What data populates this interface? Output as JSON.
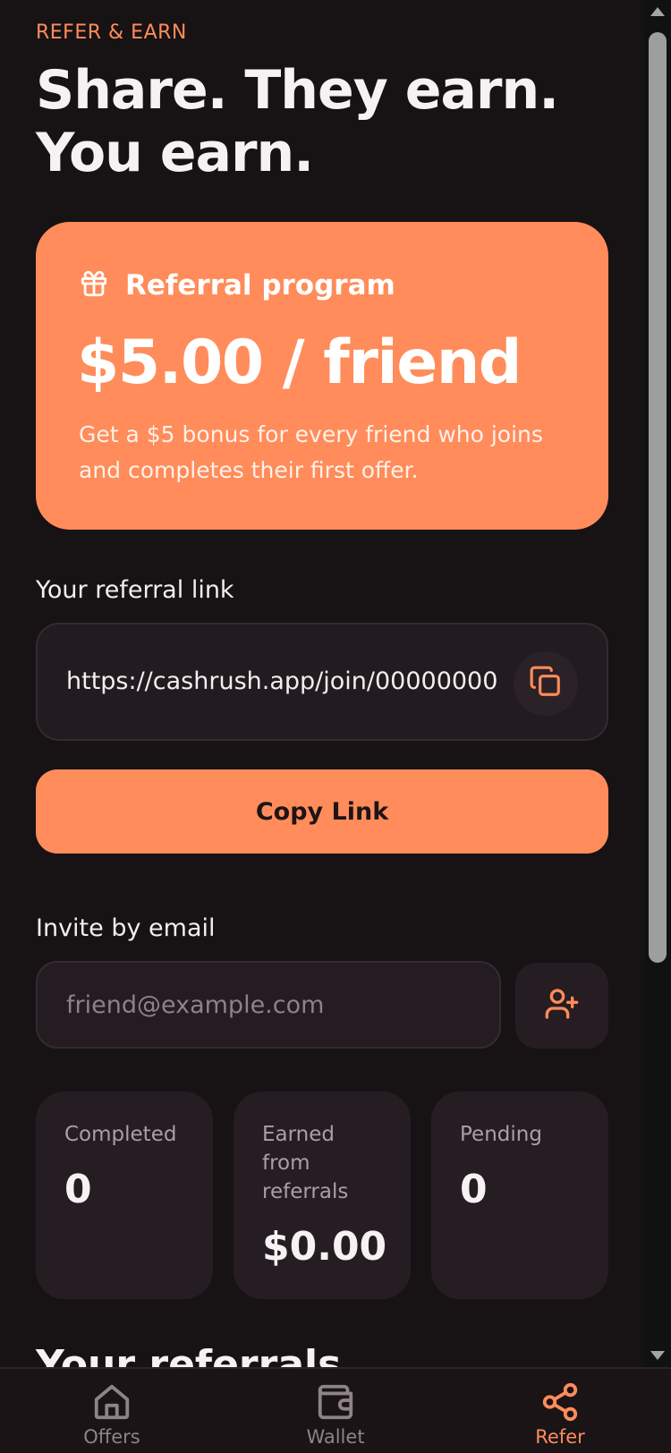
{
  "header": {
    "eyebrow": "REFER & EARN",
    "title": "Share. They earn. You earn."
  },
  "promo": {
    "icon": "gift-icon",
    "label": "Referral program",
    "amount": "$5.00 / friend",
    "description": "Get a $5 bonus for every friend who joins and completes their first offer."
  },
  "referral_link": {
    "label": "Your referral link",
    "url": "https://cashrush.app/join/00000000",
    "copy_icon": "copy-icon",
    "copy_button_label": "Copy Link"
  },
  "invite": {
    "label": "Invite by email",
    "placeholder": "friend@example.com",
    "value": "",
    "button_icon": "user-plus-icon"
  },
  "stats": [
    {
      "label": "Completed",
      "value": "0"
    },
    {
      "label": "Earned from referrals",
      "value": "$0.00"
    },
    {
      "label": "Pending",
      "value": "0"
    }
  ],
  "referrals_section": {
    "title": "Your referrals"
  },
  "nav": {
    "items": [
      {
        "label": "Offers",
        "icon": "home-icon",
        "active": false
      },
      {
        "label": "Wallet",
        "icon": "wallet-icon",
        "active": false
      },
      {
        "label": "Refer",
        "icon": "share-icon",
        "active": true
      }
    ]
  },
  "colors": {
    "background": "#171214",
    "accent": "#ff8c5a",
    "card": "#251d22",
    "muted_text": "#a99fa4"
  }
}
